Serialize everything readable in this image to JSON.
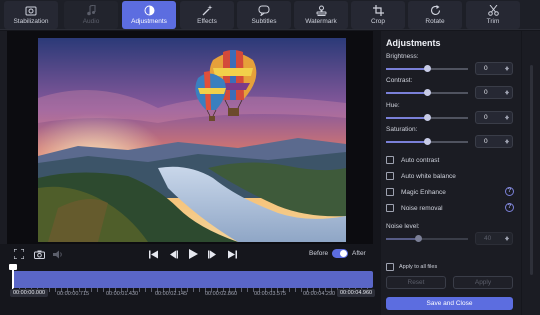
{
  "toolbar": {
    "tabs": [
      {
        "label": "Stabilization",
        "icon": "stabilization-icon",
        "state": "normal"
      },
      {
        "label": "Audio",
        "icon": "music-note-icon",
        "state": "disabled"
      },
      {
        "label": "Adjustments",
        "icon": "adjustments-icon",
        "state": "active"
      },
      {
        "label": "Effects",
        "icon": "magic-wand-icon",
        "state": "normal"
      },
      {
        "label": "Subtitles",
        "icon": "speech-bubble-icon",
        "state": "normal"
      },
      {
        "label": "Watermark",
        "icon": "stamp-icon",
        "state": "normal"
      },
      {
        "label": "Crop",
        "icon": "crop-icon",
        "state": "normal"
      },
      {
        "label": "Rotate",
        "icon": "rotate-icon",
        "state": "normal"
      },
      {
        "label": "Trim",
        "icon": "scissors-icon",
        "state": "normal"
      }
    ]
  },
  "player": {
    "before_label": "Before",
    "after_label": "After",
    "before_after_on": true
  },
  "timeline": {
    "current_time": "00:00:00.000",
    "ticks": [
      "00:00:00.715",
      "00:00:01.430",
      "00:00:02.145",
      "00:00:02.860",
      "00:00:03.575",
      "00:00:04.290"
    ],
    "end_time": "00:00:04.960",
    "playhead_fraction": 0.0
  },
  "panel": {
    "title": "Adjustments",
    "sliders": [
      {
        "label": "Brightness:",
        "value": "0",
        "fraction": 0.5
      },
      {
        "label": "Contrast:",
        "value": "0",
        "fraction": 0.5
      },
      {
        "label": "Hue:",
        "value": "0",
        "fraction": 0.5
      },
      {
        "label": "Saturation:",
        "value": "0",
        "fraction": 0.5
      }
    ],
    "checkboxes": [
      {
        "label": "Auto contrast",
        "checked": false,
        "help": false
      },
      {
        "label": "Auto white balance",
        "checked": false,
        "help": false
      },
      {
        "label": "Magic Enhance",
        "checked": false,
        "help": true
      },
      {
        "label": "Noise removal",
        "checked": false,
        "help": true
      }
    ],
    "noise": {
      "label": "Noise level:",
      "value": "40",
      "fraction": 0.4
    },
    "apply_all": "Apply to all files",
    "reset_label": "Reset",
    "apply_label": "Apply",
    "save_label": "Save and Close",
    "help_glyph": "?"
  },
  "colors": {
    "accent": "#5c6de0",
    "background": "#15161c",
    "panel": "#1b1c23"
  }
}
